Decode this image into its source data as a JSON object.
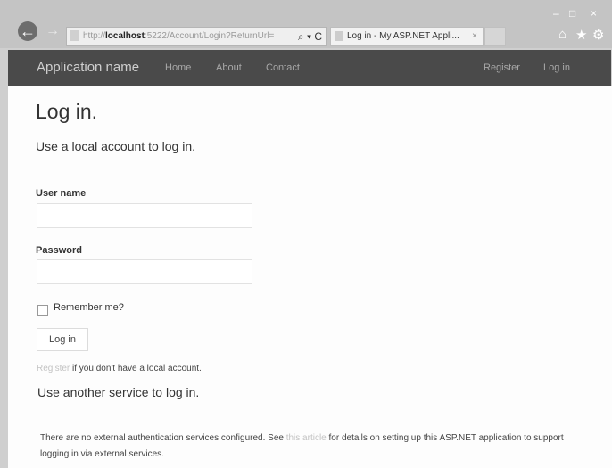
{
  "browser": {
    "address_prefix": "http://",
    "address_host": "localhost",
    "address_rest": ":5222/Account/Login?ReturnUrl=",
    "address_tools": "⌕ ▾ C",
    "tab_title": "Log in - My ASP.NET Appli...",
    "tab_close": "×",
    "back_glyph": "←",
    "forward_glyph": "→",
    "home_glyph": "⌂",
    "star_glyph": "★",
    "gear_glyph": "⚙",
    "minimize_glyph": "–",
    "maximize_glyph": "□",
    "close_glyph": "×"
  },
  "navbar": {
    "brand": "Application name",
    "links": [
      "Home",
      "About",
      "Contact"
    ],
    "right_links": [
      "Register",
      "Log in"
    ]
  },
  "page": {
    "title": "Log in.",
    "subtitle": "Use a local account to log in.",
    "username_label": "User name",
    "username_value": "",
    "password_label": "Password",
    "password_value": "",
    "remember_label": "Remember me?",
    "login_button": "Log in",
    "register_link": "Register",
    "register_suffix": " if you don't have a local account.",
    "external_title": "Use another service to log in.",
    "external_text_1": "There are no external authentication services configured. See ",
    "external_link": "this article",
    "external_text_2": " for details on setting up this ASP.NET application to support logging in via external services."
  }
}
